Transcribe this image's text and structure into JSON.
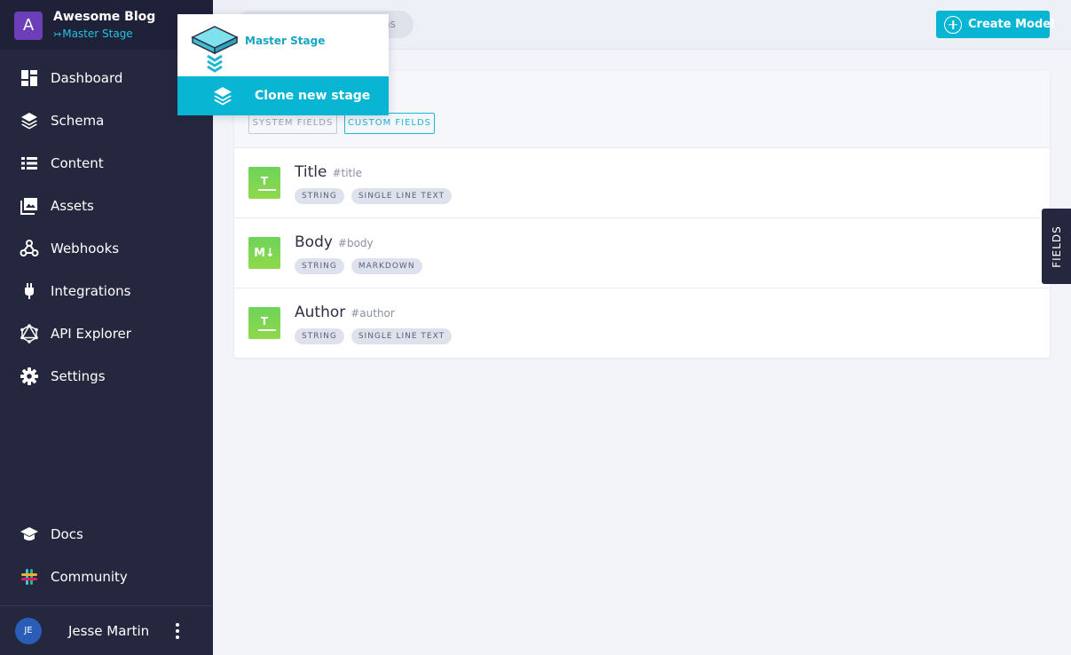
{
  "project": {
    "avatar_letter": "A",
    "name": "Awesome Blog",
    "stage_arrow": "↣",
    "stage": "Master Stage"
  },
  "nav": {
    "items": [
      {
        "label": "Dashboard",
        "icon": "dashboard-icon"
      },
      {
        "label": "Schema",
        "icon": "layers-icon"
      },
      {
        "label": "Content",
        "icon": "list-icon"
      },
      {
        "label": "Assets",
        "icon": "images-icon"
      },
      {
        "label": "Webhooks",
        "icon": "webhooks-icon"
      },
      {
        "label": "Integrations",
        "icon": "plug-icon"
      },
      {
        "label": "API Explorer",
        "icon": "graphql-icon"
      },
      {
        "label": "Settings",
        "icon": "gear-icon"
      }
    ],
    "bottom": [
      {
        "label": "Docs",
        "icon": "graduation-cap-icon"
      },
      {
        "label": "Community",
        "icon": "slack-icon"
      }
    ]
  },
  "user": {
    "initials": "JE",
    "name": "Jesse Martin"
  },
  "topbar": {
    "tab_partial": "ns",
    "create_button": "Create Model"
  },
  "panel": {
    "tabs": {
      "system": "SYSTEM FIELDS",
      "custom": "CUSTOM FIELDS"
    },
    "fields": [
      {
        "icon_text": "T",
        "name": "Title",
        "api_id": "#title",
        "tags": [
          "STRING",
          "SINGLE LINE TEXT"
        ]
      },
      {
        "icon_text": "M↓",
        "name": "Body",
        "api_id": "#body",
        "tags": [
          "STRING",
          "MARKDOWN"
        ]
      },
      {
        "icon_text": "T",
        "name": "Author",
        "api_id": "#author",
        "tags": [
          "STRING",
          "SINGLE LINE TEXT"
        ]
      }
    ]
  },
  "side_tab": {
    "label": "FIELDS"
  },
  "stage_dropdown": {
    "current": "Master Stage",
    "clone_label": "Clone new stage"
  },
  "colors": {
    "sidebar": "#25273f",
    "accent": "#08b5d3",
    "field_green": "#7ed64f",
    "project_avatar": "#6c3eb8"
  }
}
